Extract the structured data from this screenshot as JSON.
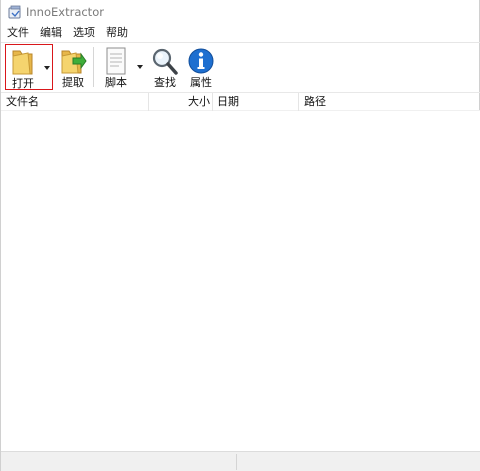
{
  "window": {
    "title": "InnoExtractor"
  },
  "menu": {
    "items": [
      "文件",
      "编辑",
      "选项",
      "帮助"
    ]
  },
  "toolbar": {
    "open_label": "打开",
    "extract_label": "提取",
    "script_label": "脚本",
    "find_label": "查找",
    "properties_label": "属性",
    "open_highlight_color": "#d9171b"
  },
  "list": {
    "columns": [
      "文件名",
      "大小",
      "日期",
      "路径"
    ],
    "rows": []
  },
  "status": {
    "panes": [
      "",
      ""
    ]
  }
}
